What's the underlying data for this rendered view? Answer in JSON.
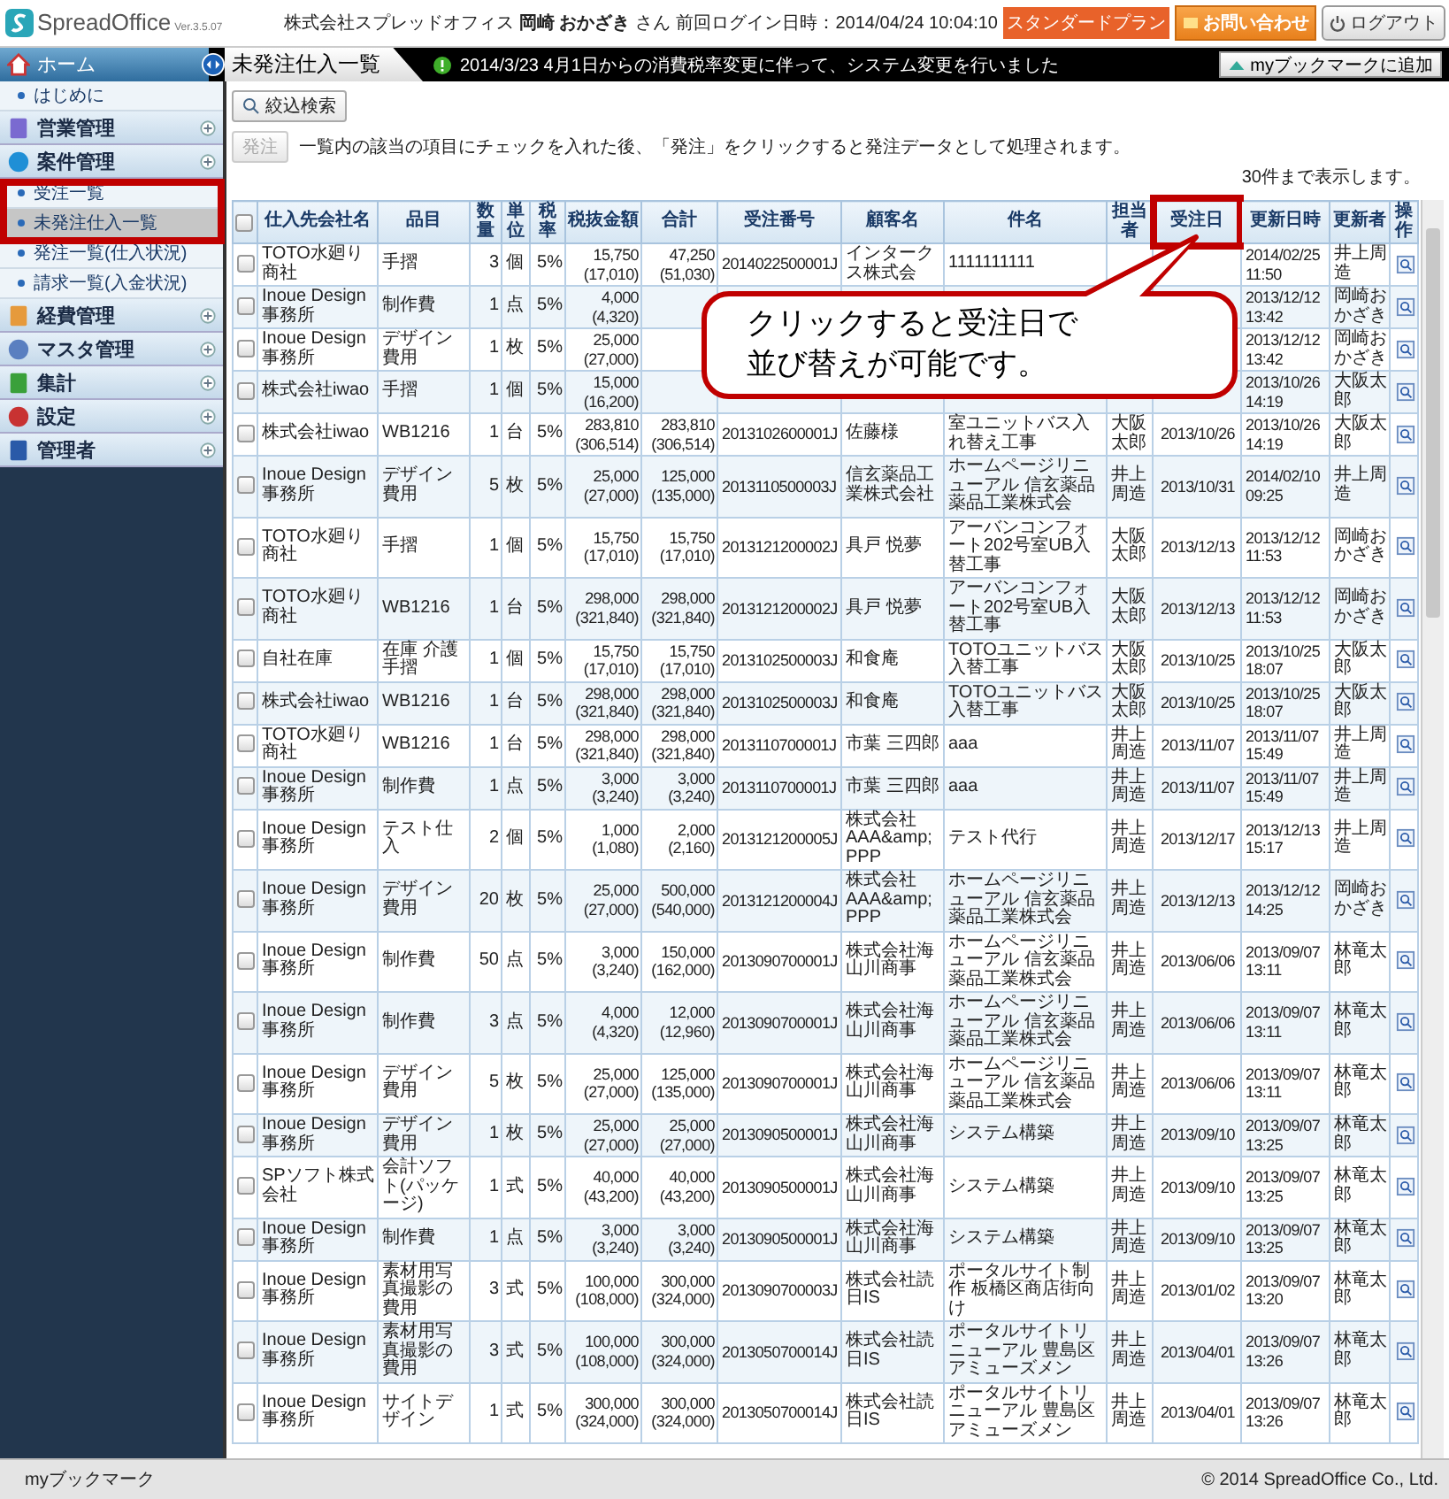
{
  "header": {
    "logo": "SpreadOffice",
    "version": "Ver.3.5.07",
    "company": "株式会社スプレッドオフィス",
    "user": "岡崎 おかざき",
    "honorific": "さん",
    "last_login": "前回ログイン日時：2014/04/24 10:04:10",
    "plan": "スタンダードプラン",
    "contact_button": "お問い合わせ",
    "logout_button": "ログアウト"
  },
  "nav": {
    "home_tab": "ホーム",
    "page_tab": "未発注仕入一覧",
    "notice": "2014/3/23  4月1日からの消費税率変更に伴って、システム変更を行いました",
    "bookmark_button": "myブックマークに追加"
  },
  "sidebar": {
    "items": [
      {
        "label": "はじめに",
        "kind": "link",
        "selected": false
      },
      {
        "label": "営業管理",
        "kind": "category",
        "selected": false
      },
      {
        "label": "案件管理",
        "kind": "category",
        "selected": false
      },
      {
        "label": "受注一覧",
        "kind": "link",
        "selected": false
      },
      {
        "label": "未発注仕入一覧",
        "kind": "link",
        "selected": true
      },
      {
        "label": "発注一覧(仕入状況)",
        "kind": "link",
        "selected": false
      },
      {
        "label": "請求一覧(入金状況)",
        "kind": "link",
        "selected": false
      },
      {
        "label": "経費管理",
        "kind": "category",
        "selected": false
      },
      {
        "label": "マスタ管理",
        "kind": "category",
        "selected": false
      },
      {
        "label": "集計",
        "kind": "category",
        "selected": false
      },
      {
        "label": "設定",
        "kind": "category",
        "selected": false
      },
      {
        "label": "管理者",
        "kind": "category",
        "selected": false
      }
    ]
  },
  "toolbar": {
    "filter_button": "絞込検索",
    "order_button": {
      "label": "発注",
      "disabled": true
    },
    "instruction": "一覧内の該当の項目にチェックを入れた後、「発注」をクリックすると発注データとして処理されます。",
    "count_text": "30件まで表示します。"
  },
  "table": {
    "select_all_checked": false,
    "columns": [
      "仕入先会社名",
      "品目",
      "数量",
      "単位",
      "税率",
      "税抜金額",
      "合計",
      "受注番号",
      "顧客名",
      "件名",
      "担当者",
      "受注日",
      "更新日時",
      "更新者",
      "操作"
    ],
    "rows": [
      {
        "checked": false,
        "supplier": "TOTO水廻り商社",
        "item": "手摺",
        "qty": "3",
        "unit": "個",
        "rate": "5%",
        "net": "15,750 (17,010)",
        "total": "47,250 (51,030)",
        "order_no": "2014022500001J",
        "customer": "インタークス株式会",
        "subject": "1111111111",
        "updated": "2014/02/25 11:50",
        "updater": "井上周造"
      },
      {
        "checked": false,
        "supplier": "Inoue Design 事務所",
        "item": "制作費",
        "qty": "1",
        "unit": "点",
        "rate": "5%",
        "net": "4,000 (4,320)",
        "updated": "2013/12/12 13:42",
        "updater": "岡崎おかざき"
      },
      {
        "checked": false,
        "supplier": "Inoue Design 事務所",
        "item": "デザイン費用",
        "qty": "1",
        "unit": "枚",
        "rate": "5%",
        "net": "25,000 (27,000)",
        "updated": "2013/12/12 13:42",
        "updater": "岡崎おかざき"
      },
      {
        "checked": false,
        "supplier": "株式会社iwao",
        "item": "手摺",
        "qty": "1",
        "unit": "個",
        "rate": "5%",
        "net": "15,000 (16,200)",
        "updated": "2013/10/26 14:19",
        "updater": "大阪太郎"
      },
      {
        "checked": false,
        "supplier": "株式会社iwao",
        "item": "WB1216",
        "qty": "1",
        "unit": "台",
        "rate": "5%",
        "net": "283,810 (306,514)",
        "total": "283,810 (306,514)",
        "order_no": "2013102600001J",
        "customer": "佐藤様",
        "subject": "室ユニットバス入れ替え工事",
        "staff": "大阪太郎",
        "order_date": "2013/10/26",
        "updated": "2013/10/26 14:19",
        "updater": "大阪太郎"
      },
      {
        "checked": false,
        "supplier": "Inoue Design 事務所",
        "item": "デザイン費用",
        "qty": "5",
        "unit": "枚",
        "rate": "5%",
        "net": "25,000 (27,000)",
        "total": "125,000 (135,000)",
        "order_no": "2013110500003J",
        "customer": "信玄薬品工業株式会社",
        "subject": "ホームページリニューアル 信玄薬品薬品工業株式会",
        "staff": "井上周造",
        "order_date": "2013/10/31",
        "updated": "2014/02/10 09:25",
        "updater": "井上周造"
      },
      {
        "checked": false,
        "supplier": "TOTO水廻り商社",
        "item": "手摺",
        "qty": "1",
        "unit": "個",
        "rate": "5%",
        "net": "15,750 (17,010)",
        "total": "15,750 (17,010)",
        "order_no": "2013121200002J",
        "customer": "具戸 悦夢",
        "subject": "アーバンコンフォート202号室UB入替工事",
        "staff": "大阪太郎",
        "order_date": "2013/12/13",
        "updated": "2013/12/12 11:53",
        "updater": "岡崎おかざき"
      },
      {
        "checked": false,
        "supplier": "TOTO水廻り商社",
        "item": "WB1216",
        "qty": "1",
        "unit": "台",
        "rate": "5%",
        "net": "298,000 (321,840)",
        "total": "298,000 (321,840)",
        "order_no": "2013121200002J",
        "customer": "具戸 悦夢",
        "subject": "アーバンコンフォート202号室UB入替工事",
        "staff": "大阪太郎",
        "order_date": "2013/12/13",
        "updated": "2013/12/12 11:53",
        "updater": "岡崎おかざき"
      },
      {
        "checked": false,
        "supplier": "自社在庫",
        "item": "在庫 介護手摺",
        "qty": "1",
        "unit": "個",
        "rate": "5%",
        "net": "15,750 (17,010)",
        "total": "15,750 (17,010)",
        "order_no": "2013102500003J",
        "customer": "和食庵",
        "subject": "TOTOユニットバス入替工事",
        "staff": "大阪太郎",
        "order_date": "2013/10/25",
        "updated": "2013/10/25 18:07",
        "updater": "大阪太郎"
      },
      {
        "checked": false,
        "supplier": "株式会社iwao",
        "item": "WB1216",
        "qty": "1",
        "unit": "台",
        "rate": "5%",
        "net": "298,000 (321,840)",
        "total": "298,000 (321,840)",
        "order_no": "2013102500003J",
        "customer": "和食庵",
        "subject": "TOTOユニットバス入替工事",
        "staff": "大阪太郎",
        "order_date": "2013/10/25",
        "updated": "2013/10/25 18:07",
        "updater": "大阪太郎"
      },
      {
        "checked": false,
        "supplier": "TOTO水廻り商社",
        "item": "WB1216",
        "qty": "1",
        "unit": "台",
        "rate": "5%",
        "net": "298,000 (321,840)",
        "total": "298,000 (321,840)",
        "order_no": "2013110700001J",
        "customer": "市葉 三四郎",
        "subject": "aaa",
        "staff": "井上周造",
        "order_date": "2013/11/07",
        "updated": "2013/11/07 15:49",
        "updater": "井上周造"
      },
      {
        "checked": false,
        "supplier": "Inoue Design 事務所",
        "item": "制作費",
        "qty": "1",
        "unit": "点",
        "rate": "5%",
        "net": "3,000 (3,240)",
        "total": "3,000 (3,240)",
        "order_no": "2013110700001J",
        "customer": "市葉 三四郎",
        "subject": "aaa",
        "staff": "井上周造",
        "order_date": "2013/11/07",
        "updated": "2013/11/07 15:49",
        "updater": "井上周造"
      },
      {
        "checked": false,
        "supplier": "Inoue Design 事務所",
        "item": "テスト仕入",
        "qty": "2",
        "unit": "個",
        "rate": "5%",
        "net": "1,000 (1,080)",
        "total": "2,000 (2,160)",
        "order_no": "2013121200005J",
        "customer": "株式会社AAA&amp;PPP",
        "subject": "テスト代行",
        "staff": "井上周造",
        "order_date": "2013/12/17",
        "updated": "2013/12/13 15:17",
        "updater": "井上周造"
      },
      {
        "checked": false,
        "supplier": "Inoue Design 事務所",
        "item": "デザイン費用",
        "qty": "20",
        "unit": "枚",
        "rate": "5%",
        "net": "25,000 (27,000)",
        "total": "500,000 (540,000)",
        "order_no": "2013121200004J",
        "customer": "株式会社AAA&amp;PPP",
        "subject": "ホームページリニューアル 信玄薬品薬品工業株式会",
        "staff": "井上周造",
        "order_date": "2013/12/13",
        "updated": "2013/12/12 14:25",
        "updater": "岡崎おかざき"
      },
      {
        "checked": false,
        "supplier": "Inoue Design 事務所",
        "item": "制作費",
        "qty": "50",
        "unit": "点",
        "rate": "5%",
        "net": "3,000 (3,240)",
        "total": "150,000 (162,000)",
        "order_no": "2013090700001J",
        "customer": "株式会社海山川商事",
        "subject": "ホームページリニューアル 信玄薬品薬品工業株式会",
        "staff": "井上周造",
        "order_date": "2013/06/06",
        "updated": "2013/09/07 13:11",
        "updater": "林竜太郎"
      },
      {
        "checked": false,
        "supplier": "Inoue Design 事務所",
        "item": "制作費",
        "qty": "3",
        "unit": "点",
        "rate": "5%",
        "net": "4,000 (4,320)",
        "total": "12,000 (12,960)",
        "order_no": "2013090700001J",
        "customer": "株式会社海山川商事",
        "subject": "ホームページリニューアル 信玄薬品薬品工業株式会",
        "staff": "井上周造",
        "order_date": "2013/06/06",
        "updated": "2013/09/07 13:11",
        "updater": "林竜太郎"
      },
      {
        "checked": false,
        "supplier": "Inoue Design 事務所",
        "item": "デザイン費用",
        "qty": "5",
        "unit": "枚",
        "rate": "5%",
        "net": "25,000 (27,000)",
        "total": "125,000 (135,000)",
        "order_no": "2013090700001J",
        "customer": "株式会社海山川商事",
        "subject": "ホームページリニューアル 信玄薬品薬品工業株式会",
        "staff": "井上周造",
        "order_date": "2013/06/06",
        "updated": "2013/09/07 13:11",
        "updater": "林竜太郎"
      },
      {
        "checked": false,
        "supplier": "Inoue Design 事務所",
        "item": "デザイン費用",
        "qty": "1",
        "unit": "枚",
        "rate": "5%",
        "net": "25,000 (27,000)",
        "total": "25,000 (27,000)",
        "order_no": "2013090500001J",
        "customer": "株式会社海山川商事",
        "subject": "システム構築",
        "staff": "井上周造",
        "order_date": "2013/09/10",
        "updated": "2013/09/07 13:25",
        "updater": "林竜太郎"
      },
      {
        "checked": false,
        "supplier": "SPソフト株式会社",
        "item": "会計ソフト(パッケージ)",
        "qty": "1",
        "unit": "式",
        "rate": "5%",
        "net": "40,000 (43,200)",
        "total": "40,000 (43,200)",
        "order_no": "2013090500001J",
        "customer": "株式会社海山川商事",
        "subject": "システム構築",
        "staff": "井上周造",
        "order_date": "2013/09/10",
        "updated": "2013/09/07 13:25",
        "updater": "林竜太郎"
      },
      {
        "checked": false,
        "supplier": "Inoue Design 事務所",
        "item": "制作費",
        "qty": "1",
        "unit": "点",
        "rate": "5%",
        "net": "3,000 (3,240)",
        "total": "3,000 (3,240)",
        "order_no": "2013090500001J",
        "customer": "株式会社海山川商事",
        "subject": "システム構築",
        "staff": "井上周造",
        "order_date": "2013/09/10",
        "updated": "2013/09/07 13:25",
        "updater": "林竜太郎"
      },
      {
        "checked": false,
        "supplier": "Inoue Design 事務所",
        "item": "素材用写真撮影の費用",
        "qty": "3",
        "unit": "式",
        "rate": "5%",
        "net": "100,000 (108,000)",
        "total": "300,000 (324,000)",
        "order_no": "2013090700003J",
        "customer": "株式会社読日IS",
        "subject": "ポータルサイト制作 板橋区商店街向け",
        "staff": "井上周造",
        "order_date": "2013/01/02",
        "updated": "2013/09/07 13:20",
        "updater": "林竜太郎"
      },
      {
        "checked": false,
        "supplier": "Inoue Design 事務所",
        "item": "素材用写真撮影の費用",
        "qty": "3",
        "unit": "式",
        "rate": "5%",
        "net": "100,000 (108,000)",
        "total": "300,000 (324,000)",
        "order_no": "2013050700014J",
        "customer": "株式会社読日IS",
        "subject": "ポータルサイトリニューアル 豊島区アミューズメン",
        "staff": "井上周造",
        "order_date": "2013/04/01",
        "updated": "2013/09/07 13:26",
        "updater": "林竜太郎"
      },
      {
        "checked": false,
        "supplier": "Inoue Design 事務所",
        "item": "サイトデザイン",
        "qty": "1",
        "unit": "式",
        "rate": "5%",
        "net": "300,000 (324,000)",
        "total": "300,000 (324,000)",
        "order_no": "2013050700014J",
        "customer": "株式会社読日IS",
        "subject": "ポータルサイトリニューアル 豊島区アミューズメン",
        "staff": "井上周造",
        "order_date": "2013/04/01",
        "updated": "2013/09/07 13:26",
        "updater": "林竜太郎"
      }
    ]
  },
  "callout": {
    "text": "クリックすると受注日で並び替えが可能です。"
  },
  "footer": {
    "bookmark": "myブックマーク",
    "copyright": "© 2014 SpreadOffice Co., Ltd."
  }
}
